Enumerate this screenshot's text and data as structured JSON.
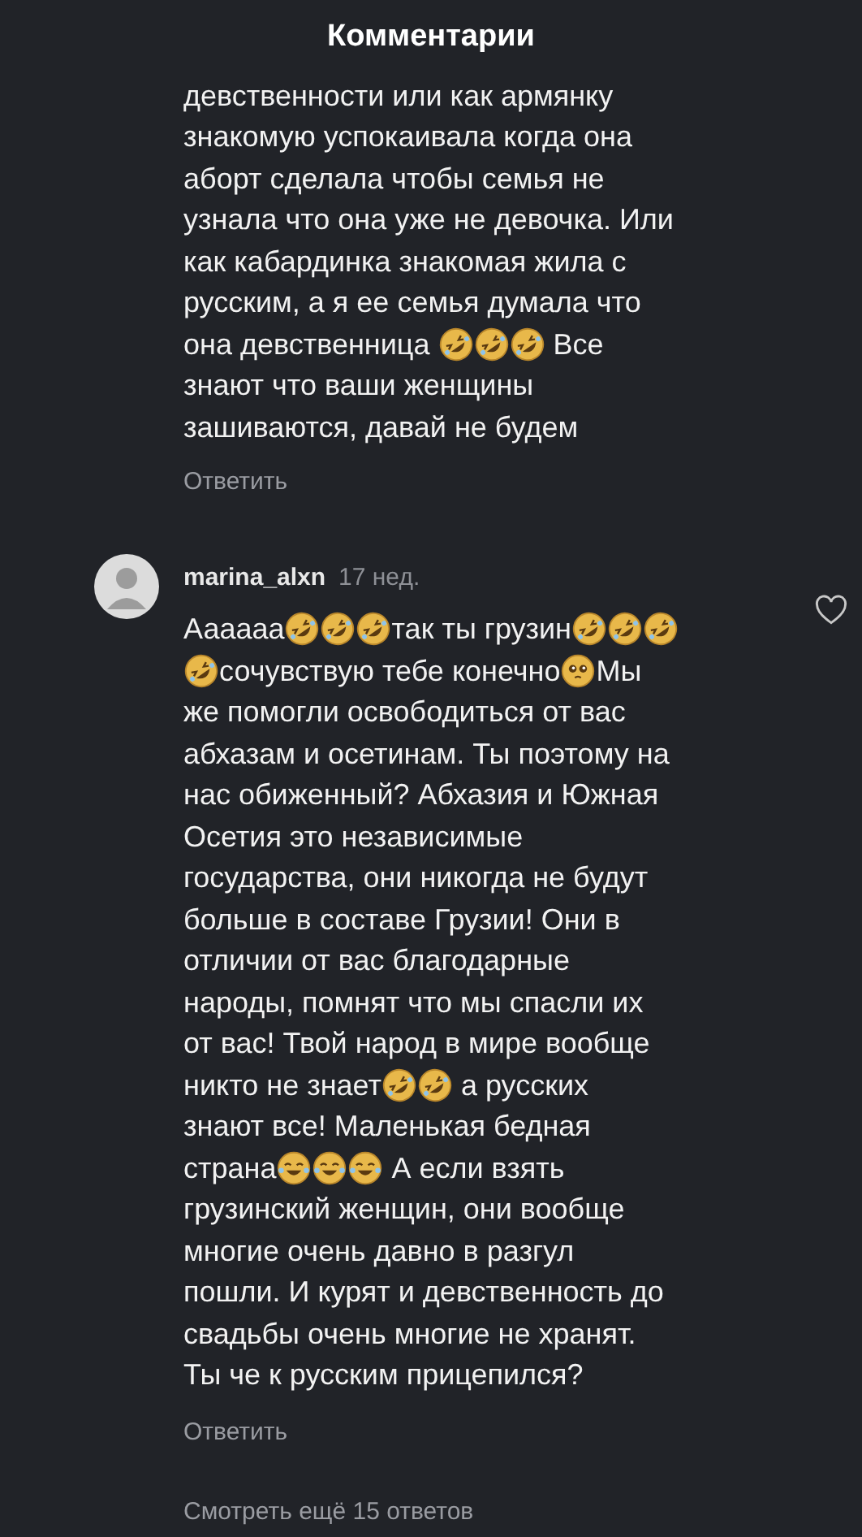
{
  "header": {
    "title": "Комментарии"
  },
  "comments": [
    {
      "lines": [
        [
          {
            "kind": "text",
            "text": "девственности или как армянку"
          }
        ],
        [
          {
            "kind": "text",
            "text": "знакомую успокаивала когда она"
          }
        ],
        [
          {
            "kind": "text",
            "text": "аборт сделала чтобы семья не"
          }
        ],
        [
          {
            "kind": "text",
            "text": "узнала что она уже не девочка. Или"
          }
        ],
        [
          {
            "kind": "text",
            "text": "как кабардинка знакомая жила с"
          }
        ],
        [
          {
            "kind": "text",
            "text": "русским, а я ее семья думала что"
          }
        ],
        [
          {
            "kind": "text",
            "text": "она девственница "
          },
          {
            "kind": "rofl"
          },
          {
            "kind": "rofl"
          },
          {
            "kind": "rofl"
          },
          {
            "kind": "text",
            "text": " Все"
          }
        ],
        [
          {
            "kind": "text",
            "text": "знают что ваши женщины"
          }
        ],
        [
          {
            "kind": "text",
            "text": "зашиваются, давай не будем"
          }
        ]
      ],
      "reply": "Ответить"
    },
    {
      "author": "marina_alxn",
      "time": "17 нед.",
      "liked": false,
      "lines": [
        [
          {
            "kind": "text",
            "text": "Аааааа"
          },
          {
            "kind": "rofl"
          },
          {
            "kind": "rofl"
          },
          {
            "kind": "rofl"
          },
          {
            "kind": "text",
            "text": "так ты грузин"
          },
          {
            "kind": "rofl"
          },
          {
            "kind": "rofl"
          },
          {
            "kind": "rofl"
          }
        ],
        [
          {
            "kind": "rofl"
          },
          {
            "kind": "text",
            "text": "сочувствую тебе конечно"
          },
          {
            "kind": "pleading"
          },
          {
            "kind": "text",
            "text": "Мы"
          }
        ],
        [
          {
            "kind": "text",
            "text": "же помогли освободиться от вас"
          }
        ],
        [
          {
            "kind": "text",
            "text": "абхазам и осетинам. Ты поэтому на"
          }
        ],
        [
          {
            "kind": "text",
            "text": "нас обиженный? Абхазия и Южная"
          }
        ],
        [
          {
            "kind": "text",
            "text": "Осетия это независимые"
          }
        ],
        [
          {
            "kind": "text",
            "text": "государства, они никогда не будут"
          }
        ],
        [
          {
            "kind": "text",
            "text": "больше в составе Грузии! Они в"
          }
        ],
        [
          {
            "kind": "text",
            "text": "отличии от вас благодарные"
          }
        ],
        [
          {
            "kind": "text",
            "text": "народы, помнят что мы спасли их"
          }
        ],
        [
          {
            "kind": "text",
            "text": "от вас! Твой народ в мире вообще"
          }
        ],
        [
          {
            "kind": "text",
            "text": "никто не знает"
          },
          {
            "kind": "rofl"
          },
          {
            "kind": "rofl"
          },
          {
            "kind": "text",
            "text": " а русских"
          }
        ],
        [
          {
            "kind": "text",
            "text": "знают все! Маленькая бедная"
          }
        ],
        [
          {
            "kind": "text",
            "text": "страна"
          },
          {
            "kind": "joy"
          },
          {
            "kind": "joy"
          },
          {
            "kind": "joy"
          },
          {
            "kind": "text",
            "text": " А если взять"
          }
        ],
        [
          {
            "kind": "text",
            "text": "грузинский женщин, они вообще"
          }
        ],
        [
          {
            "kind": "text",
            "text": "многие очень давно в разгул"
          }
        ],
        [
          {
            "kind": "text",
            "text": "пошли. И курят и девственность до"
          }
        ],
        [
          {
            "kind": "text",
            "text": "свадьбы очень многие не хранят."
          }
        ],
        [
          {
            "kind": "text",
            "text": "Ты че к русским прицепился?"
          }
        ]
      ],
      "reply": "Ответить"
    }
  ],
  "more_replies": "Смотреть ещё 15 ответов"
}
